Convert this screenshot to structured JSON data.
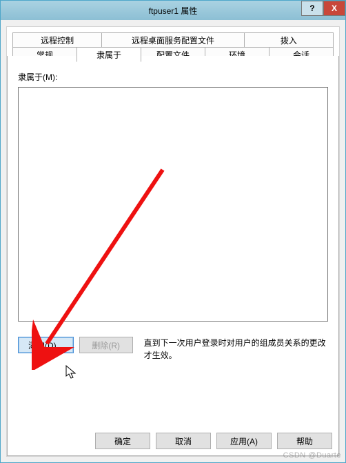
{
  "window": {
    "title": "ftpuser1 属性",
    "help_symbol": "?",
    "close_symbol": "X"
  },
  "tabs": {
    "row1": [
      "远程控制",
      "远程桌面服务配置文件",
      "拨入"
    ],
    "row2": [
      "常规",
      "隶属于",
      "配置文件",
      "环境",
      "会话"
    ]
  },
  "content": {
    "group_label": "隶属于(M):",
    "add_btn": "添加(D)...",
    "remove_btn": "删除(R)",
    "hint": "直到下一次用户登录时对用户的组成员关系的更改才生效。"
  },
  "buttons": {
    "ok": "确定",
    "cancel": "取消",
    "apply": "应用(A)",
    "help": "帮助"
  },
  "watermark": "CSDN @Duarte"
}
